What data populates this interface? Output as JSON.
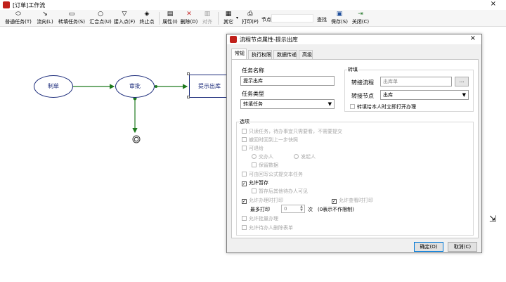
{
  "window": {
    "title": "[订单]工作流",
    "close": "×"
  },
  "toolbar": {
    "items": [
      {
        "label": "普通任务(T)",
        "icon": "ellipse-icon"
      },
      {
        "label": "流向(L)",
        "icon": "flow-icon"
      },
      {
        "label": "转填任务(S)",
        "icon": "arrow-shape-icon"
      },
      {
        "label": "汇合点(U)",
        "icon": "circle-icon"
      },
      {
        "label": "接入点(F)",
        "icon": "triangle-down-icon"
      },
      {
        "label": "终止点",
        "icon": "stop-icon"
      },
      {
        "label": "属性(I)",
        "icon": "properties-icon"
      },
      {
        "label": "删除(D)",
        "icon": "delete-icon"
      },
      {
        "label": "对齐",
        "icon": "align-icon"
      },
      {
        "label": "其它",
        "icon": "other-icon"
      },
      {
        "label": "打印(P)",
        "icon": "print-icon"
      },
      {
        "label": "保存(S)",
        "icon": "save-icon"
      },
      {
        "label": "关闭(C)",
        "icon": "exit-icon"
      }
    ],
    "search_label": "节点",
    "search_value": "",
    "find_label": "查找"
  },
  "canvas": {
    "nodes": [
      {
        "id": "n1",
        "label": "制单",
        "shape": "ellipse"
      },
      {
        "id": "n2",
        "label": "审批",
        "shape": "ellipse"
      },
      {
        "id": "n3",
        "label": "提示出库",
        "shape": "rect"
      }
    ]
  },
  "dialog": {
    "title": "流程节点属性-提示出库",
    "tabs": [
      "常规",
      "执行权限",
      "数据传递",
      "高级"
    ],
    "active_tab": "常规",
    "task_name_label": "任务名称",
    "task_name_value": "提示出库",
    "task_type_label": "任务类型",
    "task_type_value": "转填任务",
    "transfer_group_label": "转填",
    "transfer_flow_label": "转接流程",
    "transfer_flow_value": "出库单",
    "browse_button": "...",
    "transfer_node_label": "转接节点",
    "transfer_node_value": "出库",
    "open_immediately_label": "转填给本人时立即打开办理",
    "options_group_label": "选项",
    "options": {
      "read_only": "只读任务，待办事宜只需要看，不需要提交",
      "back_to_previous": "撤回时回到上一步快照",
      "can_return": "可退给",
      "return_to_handler": "交办人",
      "return_to_initiator": "发起人",
      "keep_data": "保留数据",
      "formula_submit": "可由回写公式提交本任务",
      "allow_pause": "允许暂存",
      "pause_visible": "暂存后其他待办人可见",
      "allow_print_when_handling": "允许办理时打印",
      "allow_print_when_viewing": "允许查看时打印",
      "max_print_label": "最多打印",
      "max_print_value": "0",
      "max_print_unit": "次",
      "max_print_hint": "(0表示不作限制)",
      "allow_batch": "允许批量办理",
      "allow_delete_form": "允许待办人删除表单"
    },
    "ok_button": "确定(O)",
    "cancel_button": "取消(C)",
    "close": "×"
  },
  "colors": {
    "node_stroke": "#1a2a7a",
    "edge": "#1e7a1e",
    "app_icon": "#c0201a"
  }
}
